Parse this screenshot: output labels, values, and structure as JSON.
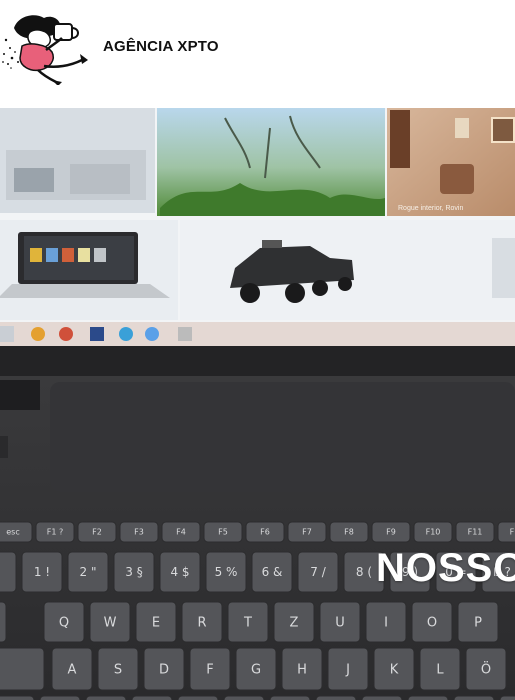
{
  "header": {
    "brand": "AGÊNCIA XPTO",
    "logo_icon": "mascot-logo-icon"
  },
  "hero": {
    "title": "NOSSO",
    "screen_caption": "Rogue interior, Rovin",
    "function_keys": [
      "esc",
      "F1 ?",
      "F2",
      "F3",
      "F4",
      "F5",
      "F6",
      "F7",
      "F8",
      "F9",
      "F10",
      "F11",
      "F12"
    ],
    "number_row": [
      "^",
      "1 !",
      "2 \"",
      "3 §",
      "4 $",
      "5 %",
      "6 &",
      "7 /",
      "8 (",
      "9 )",
      "0 =",
      "ß ?"
    ],
    "qwertz_row": [
      "Q",
      "W",
      "E",
      "R",
      "T",
      "Z",
      "U",
      "I",
      "O",
      "P"
    ],
    "asdf_row": [
      "A",
      "S",
      "D",
      "F",
      "G",
      "H",
      "J",
      "K",
      "L",
      "Ö"
    ]
  }
}
